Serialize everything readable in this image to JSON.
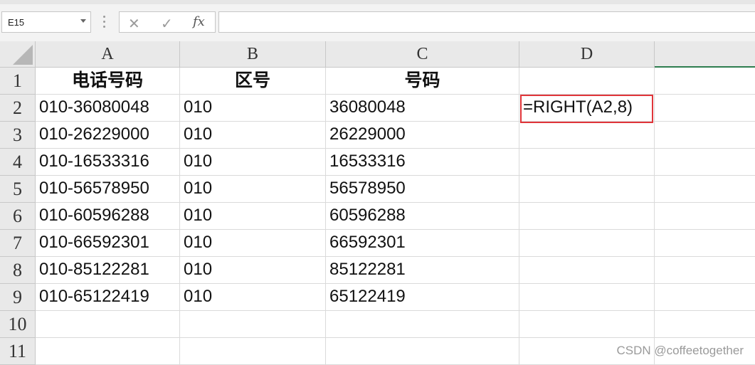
{
  "formula_bar": {
    "name_box": "E15",
    "cancel_icon": "✕",
    "enter_icon": "✓",
    "fx_label": "fx",
    "formula_value": ""
  },
  "columns": [
    "A",
    "B",
    "C",
    "D"
  ],
  "rows": [
    "1",
    "2",
    "3",
    "4",
    "5",
    "6",
    "7",
    "8",
    "9",
    "10",
    "11"
  ],
  "header_row": [
    "电话号码",
    "区号",
    "号码"
  ],
  "data_rows": [
    [
      "010-36080048",
      "010",
      "36080048",
      "=RIGHT(A2,8)"
    ],
    [
      "010-26229000",
      "010",
      "26229000",
      ""
    ],
    [
      "010-16533316",
      "010",
      "16533316",
      ""
    ],
    [
      "010-56578950",
      "010",
      "56578950",
      ""
    ],
    [
      "010-60596288",
      "010",
      "60596288",
      ""
    ],
    [
      "010-66592301",
      "010",
      "66592301",
      ""
    ],
    [
      "010-85122281",
      "010",
      "85122281",
      ""
    ],
    [
      "010-65122419",
      "010",
      "65122419",
      ""
    ]
  ],
  "watermark": "CSDN @coffeetogether",
  "colors": {
    "highlight": "#e0353a",
    "accent_green": "#2e7d4f"
  }
}
